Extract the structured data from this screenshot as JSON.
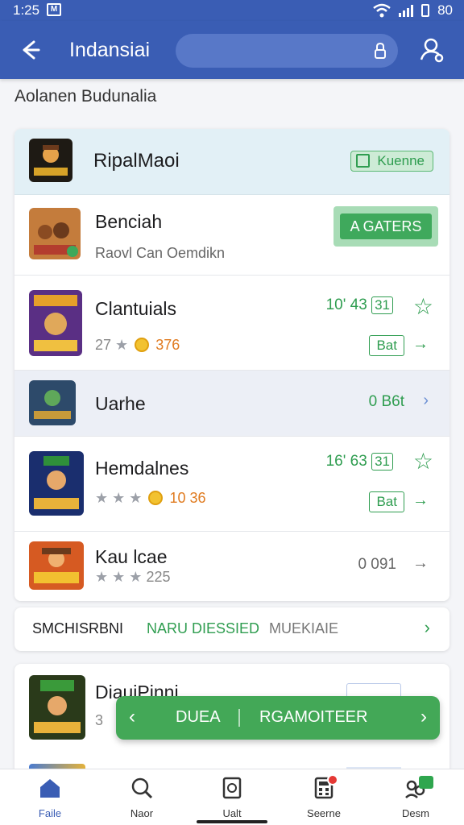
{
  "status": {
    "time": "1:25",
    "sim": "M",
    "battery": "80"
  },
  "appbar": {
    "title": "Indansiai"
  },
  "subtitle": "Aolanen Budunalia",
  "section": {
    "title": "RipalMaoi",
    "header_button": "Kuenne",
    "rows": [
      {
        "name": "Benciah",
        "sub": "Raovl Can Oemdikn",
        "action": "A GATERS"
      },
      {
        "name": "Clantuials",
        "rating_count": "27",
        "coin_value": "376",
        "price": "10' 43",
        "price_box": "31",
        "button": "Bat"
      },
      {
        "name": "Uarhe",
        "price": "0 B6t"
      },
      {
        "name": "Hemdalnes",
        "coin_value": "10 36",
        "price": "16' 63",
        "price_box": "31",
        "button": "Bat"
      },
      {
        "name": "Kau lcae",
        "rating_count": "225",
        "price": "0 091"
      }
    ]
  },
  "links": {
    "first": "SMCHISRBNI",
    "second": "NARU DIESSIED",
    "third": "MUEKIAIE"
  },
  "bottom": {
    "name": "DiauiPinni",
    "small": "3"
  },
  "snackbar": {
    "left": "DUEA",
    "right": "RGAMOITEER"
  },
  "nav": [
    {
      "label": "Faile",
      "icon": "home-icon"
    },
    {
      "label": "Naor",
      "icon": "search-icon"
    },
    {
      "label": "Ualt",
      "icon": "document-icon"
    },
    {
      "label": "Seerne",
      "icon": "calculator-icon"
    },
    {
      "label": "Desm",
      "icon": "community-icon"
    }
  ],
  "colors": {
    "primary": "#3a5db4",
    "accent_green": "#2f9d50"
  }
}
